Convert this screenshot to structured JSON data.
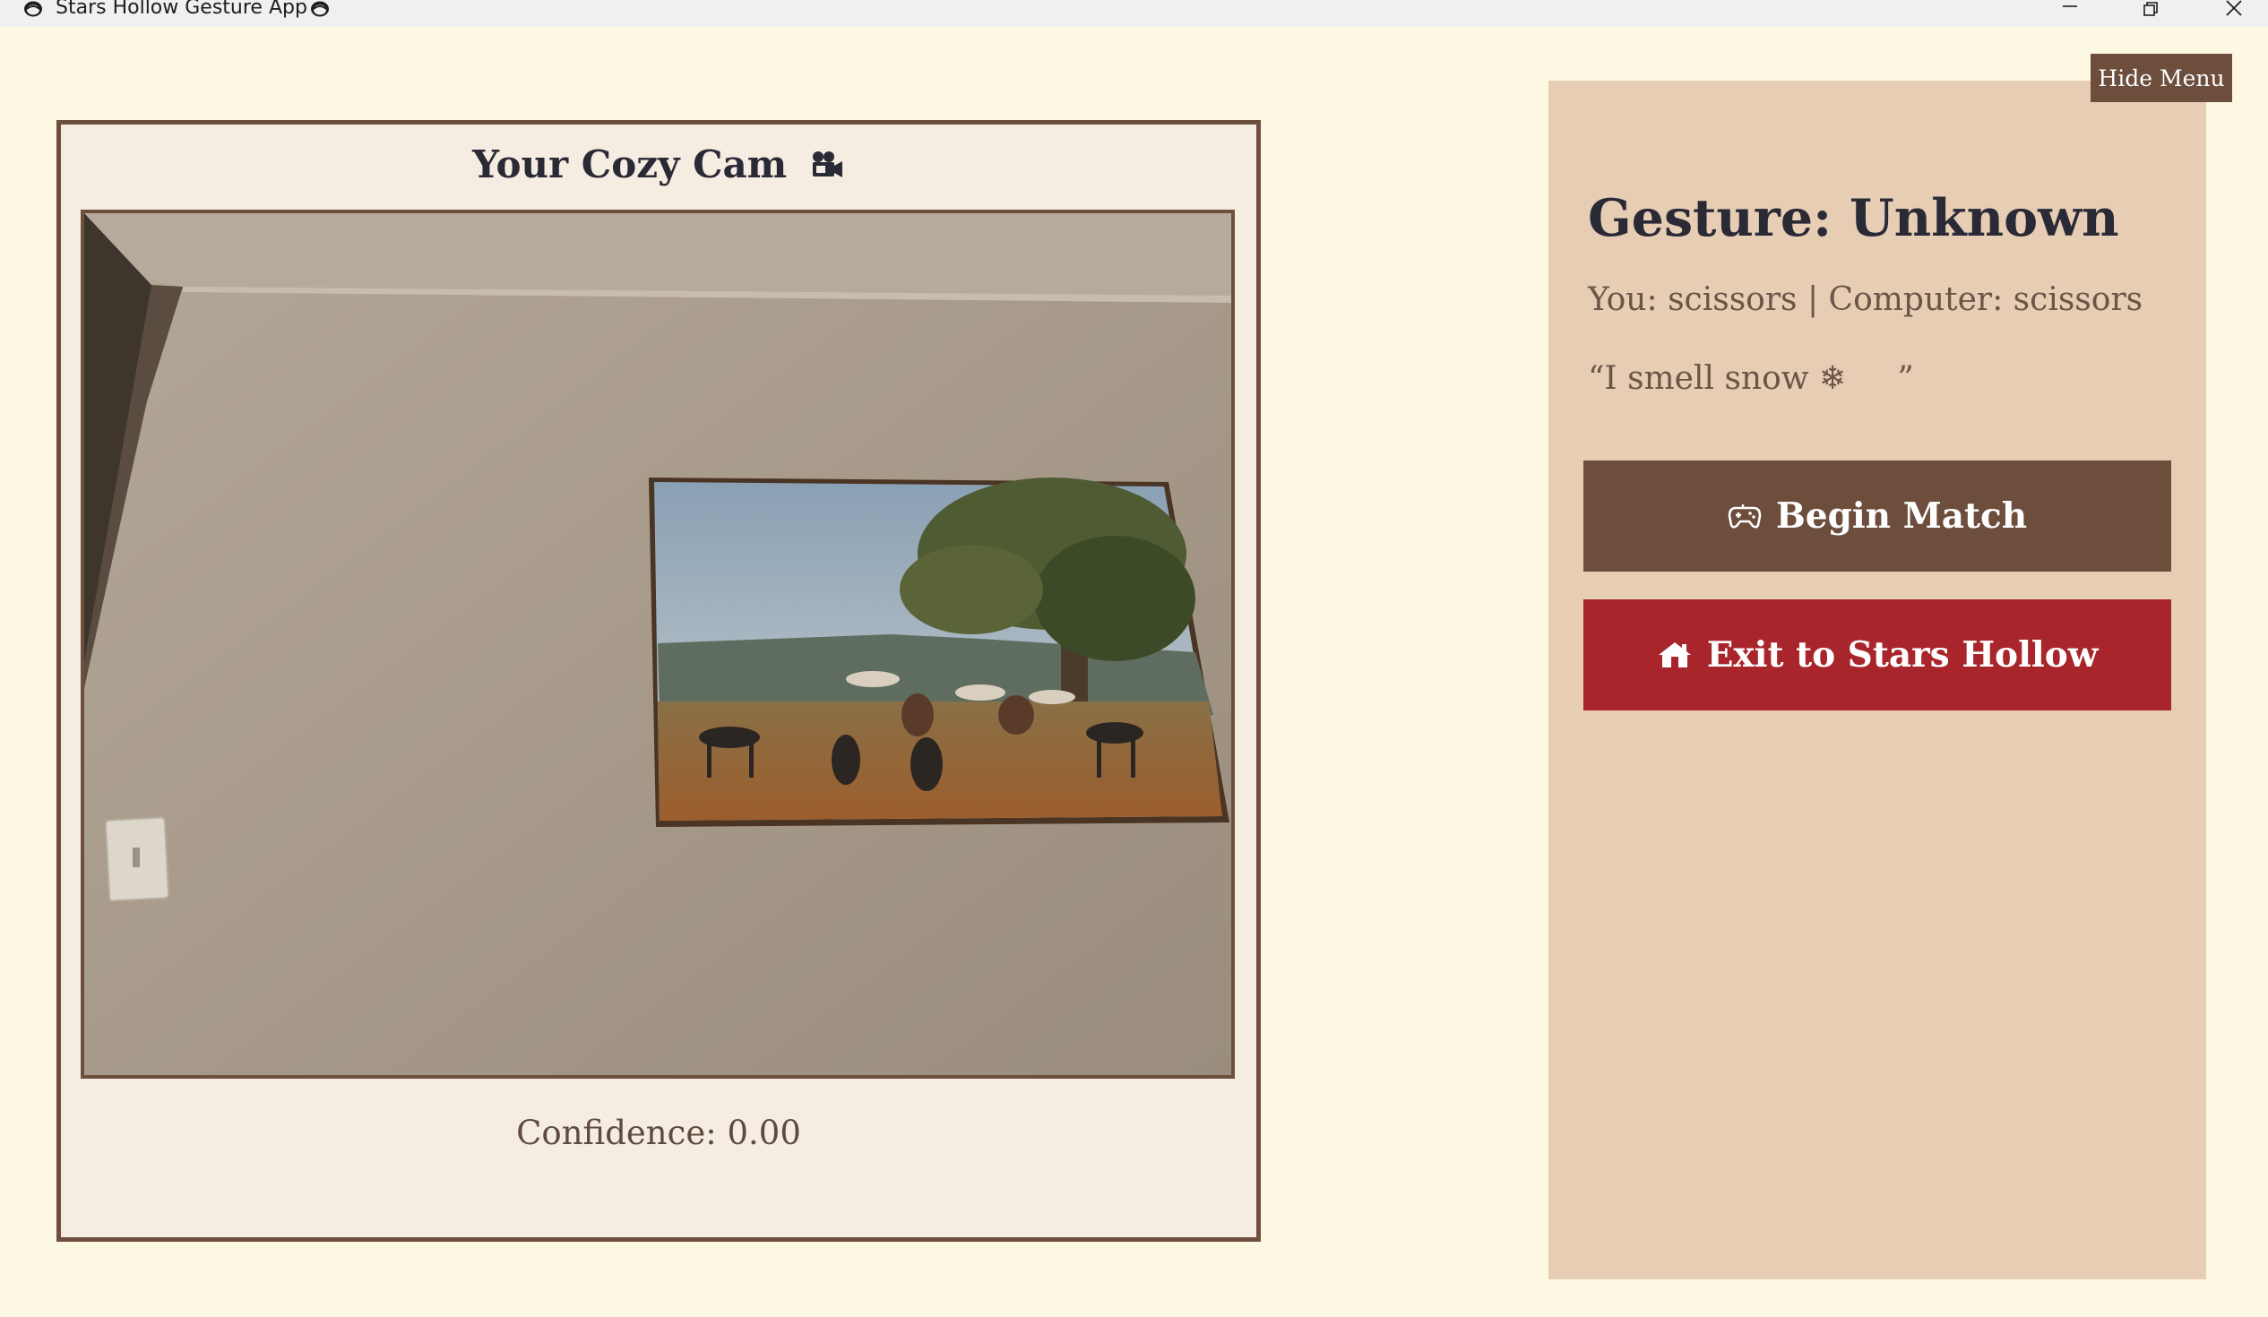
{
  "window": {
    "title": "Stars Hollow Gesture App",
    "title_icon": "lorelai-face-icon",
    "controls": [
      "minimize",
      "restore",
      "close"
    ]
  },
  "camera": {
    "title": "Your Cozy Cam",
    "title_icon": "video-camera-icon",
    "confidence_label": "Confidence: 0.00"
  },
  "menu": {
    "hide_label": "Hide Menu",
    "gesture_label": "Gesture: Unknown",
    "score_line": "You: scissors | Computer: scissors",
    "quote": "“I smell snow ❄     ”",
    "begin_label": "Begin Match",
    "begin_icon": "game-controller-icon",
    "exit_label": "Exit to Stars Hollow",
    "exit_icon": "house-icon"
  },
  "colors": {
    "background": "#fdf8e2",
    "panel": "#f5ede1",
    "border": "#6e4f3e",
    "menu_bg": "#e6cdb4",
    "primary_button": "#6d4d3c",
    "danger_button": "#a8262b",
    "heading_text": "#2a2a36",
    "body_text": "#6a5547"
  }
}
